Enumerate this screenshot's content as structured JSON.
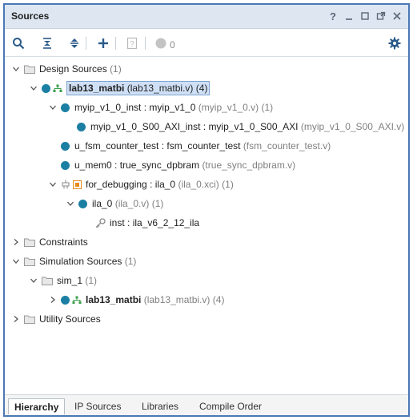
{
  "panel": {
    "title": "Sources",
    "window_icons": [
      "help-icon",
      "minimize-icon",
      "maximize-icon",
      "float-icon",
      "close-icon"
    ],
    "help_label": "?"
  },
  "toolbar": {
    "icons": [
      "search-icon",
      "collapse-all-icon",
      "expand-all-icon",
      "add-icon",
      "unknown-help-icon",
      "status-circle-icon",
      "gear-icon"
    ],
    "count": "0"
  },
  "tree": {
    "design_sources": {
      "label": "Design Sources",
      "count": "(1)"
    },
    "top": {
      "name": "lab13_matbi",
      "file": "(lab13_matbi.v)",
      "count": "(4)"
    },
    "myip": {
      "inst": "myip_v1_0_inst",
      "sep": " : ",
      "module": "myip_v1_0",
      "file": "(myip_v1_0.v)",
      "count": "(1)"
    },
    "axi": {
      "inst": "myip_v1_0_S00_AXI_inst",
      "sep": " : ",
      "module": "myip_v1_0_S00_AXI",
      "file": "(myip_v1_0_S00_AXI.v)"
    },
    "fsm": {
      "inst": "u_fsm_counter_test",
      "sep": " : ",
      "module": "fsm_counter_test",
      "file": "(fsm_counter_test.v)"
    },
    "mem": {
      "inst": "u_mem0",
      "sep": " : ",
      "module": "true_sync_dpbram",
      "file": "(true_sync_dpbram.v)"
    },
    "dbg": {
      "inst": "for_debugging",
      "sep": " : ",
      "module": "ila_0",
      "file": "(ila_0.xci)",
      "count": "(1)"
    },
    "ila": {
      "name": "ila_0",
      "file": "(ila_0.v)",
      "count": "(1)"
    },
    "inst": {
      "inst": "inst",
      "sep": " : ",
      "module": "ila_v6_2_12_ila"
    },
    "constraints": {
      "label": "Constraints"
    },
    "sim_sources": {
      "label": "Simulation Sources",
      "count": "(1)"
    },
    "sim1": {
      "label": "sim_1",
      "count": "(1)"
    },
    "sim_top": {
      "name": "lab13_matbi",
      "file": "(lab13_matbi.v)",
      "count": "(4)"
    },
    "utility": {
      "label": "Utility Sources"
    }
  },
  "tabs": [
    "Hierarchy",
    "IP Sources",
    "Libraries",
    "Compile Order"
  ],
  "active_tab": "Hierarchy",
  "colors": {
    "accent": "#4a78b4",
    "titlebar": "#dde6f1",
    "module_dot": "#1b7fa3",
    "selection": "#cfe0f6"
  }
}
